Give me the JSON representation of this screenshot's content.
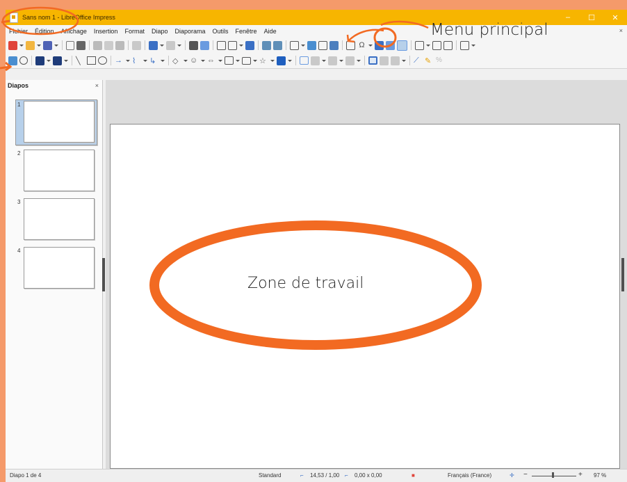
{
  "window": {
    "title": "Sans nom 1 - LibreOffice Impress",
    "controls": [
      "–",
      "☐",
      "✕"
    ]
  },
  "menu": {
    "items": [
      "Fichier",
      "Édition",
      "Affichage",
      "Insertion",
      "Format",
      "Diapo",
      "Diaporama",
      "Outils",
      "Fenêtre",
      "Aide"
    ],
    "close": "×"
  },
  "slide_pane": {
    "title": "Diapos",
    "close": "×",
    "slides": [
      "1",
      "2",
      "3",
      "4"
    ],
    "selected_index": 0
  },
  "status": {
    "slide": "Diapo 1 de 4",
    "layout": "Standard",
    "position": "14,53 / 1,00",
    "size": "0,00 x 0,00",
    "language": "Français (France)",
    "zoom_minus": "−",
    "zoom_plus": "+",
    "zoom": "97 %"
  },
  "annotations": {
    "menu_label": "Menu principal",
    "work_label": "Zone de travail"
  },
  "colors": {
    "accent_orange": "#f26a22",
    "title_bar": "#f7b500",
    "background": "#f59a6a",
    "selection": "#b7d0ea"
  }
}
